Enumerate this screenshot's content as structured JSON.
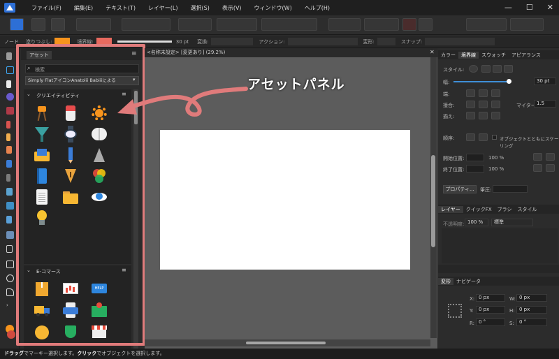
{
  "menu": [
    "ファイル(F)",
    "編集(E)",
    "テキスト(T)",
    "レイヤー(L)",
    "選択(S)",
    "表示(V)",
    "ウィンドウ(W)",
    "ヘルプ(H)"
  ],
  "context_bar": {
    "node": "ノード",
    "fill": "塗りつぶし:",
    "stroke": "境界線:",
    "stroke_width": "30 pt",
    "transform": "変換:",
    "action": "アクション:",
    "transform2": "変形:",
    "snap": "スナップ:"
  },
  "document_tab": "<名称未設定> [変更あり] (29.2%)",
  "assets_panel": {
    "tab": "アセット",
    "search_placeholder": "検索",
    "selector": "Simply FlatアイコンAnatolii Babiiiによる",
    "category1": "クリエイティビティ",
    "category2": "E-コマース",
    "icons1": [
      "tripod-icon",
      "eraser-icon",
      "gear-badge-icon",
      "funnel-icon",
      "watch-icon",
      "brain-icon",
      "email-icon",
      "pencil-icon",
      "paper-plane-icon",
      "book-icon",
      "pen-nib-icon",
      "color-wheel-icon",
      "document-icon",
      "folder-icon",
      "eye-icon",
      "lightbulb-icon"
    ],
    "icons2": [
      "package-icon",
      "presentation-chart-icon",
      "help-sign-icon",
      "truck-icon",
      "credit-card-icon",
      "map-pin-icon",
      "coin-icon",
      "shield-icon",
      "store-icon"
    ]
  },
  "callout_text": "アセットパネル",
  "stroke_panel": {
    "tabs": [
      "カラー",
      "境界線",
      "スウォッチ",
      "アピアランス"
    ],
    "style": "スタイル:",
    "width_label": "幅:",
    "width_value": "30 pt",
    "cap": "端:",
    "join": "接合:",
    "miter_label": "マイター:",
    "miter_value": "1.5",
    "align": "揃え:",
    "order": "順序:",
    "scale_label": "オブジェクトとともにスケーリング",
    "start": "開始位置:",
    "end": "終了位置:",
    "pct1": "100 %",
    "pct2": "100 %",
    "properties": "プロパティ...",
    "pressure": "筆圧:"
  },
  "layers_panel": {
    "tabs": [
      "レイヤー",
      "クイックFX",
      "ブラシ",
      "スタイル"
    ],
    "opacity_label": "不透明度:",
    "opacity": "100 %",
    "blend": "標準"
  },
  "transform_panel": {
    "tabs": [
      "変形",
      "ナビゲータ"
    ],
    "x": "X:",
    "xv": "0 px",
    "w": "W:",
    "wv": "0 px",
    "y": "Y:",
    "yv": "0 px",
    "h": "H:",
    "hv": "0 px",
    "r": "R:",
    "rv": "0 °",
    "s": "S:",
    "sv": "0 °"
  },
  "status": {
    "b1": "ドラッグ",
    "t1": "でマーキー選択します。",
    "b2": "クリック",
    "t2": "でオブジェクトを選択します。"
  },
  "colors": {
    "accent": "#e07b7b",
    "fill": "#f7941d",
    "stroke": "#e86a5f",
    "bg": "#2b2b2b"
  }
}
